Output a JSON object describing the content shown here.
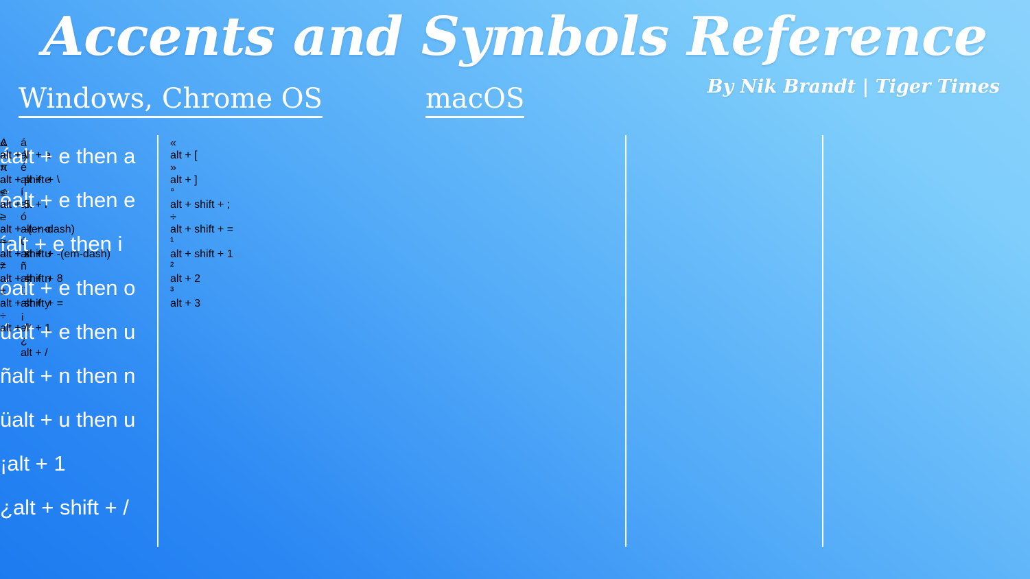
{
  "title": "Accents and Symbols Reference",
  "byline": "By Nik Brandt | Tiger Times",
  "headings": {
    "windows": "Windows, Chrome OS",
    "macos": "macOS"
  },
  "columns": [
    {
      "id": "col-1",
      "group": "windows",
      "rows": [
        {
          "symbol": "á",
          "keys": "alt + a"
        },
        {
          "symbol": "é",
          "keys": "alt + e"
        },
        {
          "symbol": "í",
          "keys": "alt + i"
        },
        {
          "symbol": "ó",
          "keys": "alt + o"
        },
        {
          "symbol": "ú",
          "keys": "alt + u"
        },
        {
          "symbol": "ñ",
          "keys": "alt + n"
        },
        {
          "symbol": "ü",
          "keys": "alt + y"
        },
        {
          "symbol": "¡",
          "keys": "alt + 1"
        },
        {
          "symbol": "¿",
          "keys": "alt + /"
        }
      ]
    },
    {
      "id": "col-2",
      "group": "windows",
      "rows": [
        {
          "symbol": "«",
          "keys": "alt + ["
        },
        {
          "symbol": "»",
          "keys": "alt + ]"
        },
        {
          "symbol": "",
          "keys": ""
        },
        {
          "symbol": "°",
          "keys": "alt + shift + ;"
        },
        {
          "symbol": "÷",
          "keys": "alt + shift + ="
        },
        {
          "symbol": "¹",
          "keys": "alt + shift + 1"
        },
        {
          "symbol": "²",
          "keys": "alt + 2"
        },
        {
          "symbol": "³",
          "keys": "alt + 3"
        },
        {
          "symbol": "",
          "keys": ""
        }
      ]
    },
    {
      "id": "col-3",
      "group": "macos",
      "rows": [
        {
          "symbol": "á",
          "keys": "alt + e then a"
        },
        {
          "symbol": "é",
          "keys": "alt + e then e"
        },
        {
          "symbol": "í",
          "keys": "alt + e then i"
        },
        {
          "symbol": "ó",
          "keys": "alt + e then o"
        },
        {
          "symbol": "ú",
          "keys": "alt + e then u"
        },
        {
          "symbol": "ñ",
          "keys": "alt + n then n"
        },
        {
          "symbol": "ü",
          "keys": "alt + u then u"
        },
        {
          "symbol": "¡",
          "keys": "alt + 1",
          "align": "center"
        },
        {
          "symbol": "¿",
          "keys": "alt + shift + /"
        }
      ]
    },
    {
      "id": "col-4",
      "group": "macos",
      "rows": [
        {
          "symbol": "«",
          "keys": "alt + \\"
        },
        {
          "symbol": "»",
          "keys": "alt + shift + \\"
        },
        {
          "symbol": "",
          "keys": ""
        },
        {
          "symbol": "≤",
          "keys": "alt + ,"
        },
        {
          "symbol": "≥",
          "keys": "alt + ."
        },
        {
          "symbol": "≈",
          "keys": "alt + x"
        },
        {
          "symbol": "≠",
          "keys": "alt + ="
        },
        {
          "symbol": "±",
          "keys": "alt + shift + ="
        },
        {
          "symbol": "÷",
          "keys": "alt + /"
        }
      ]
    },
    {
      "id": "col-5",
      "group": "macos",
      "rows": [
        {
          "symbol": "Δ",
          "keys": "alt + j"
        },
        {
          "symbol": "π",
          "keys": "alt + p"
        },
        {
          "symbol": "∞",
          "keys": "alt + 5"
        },
        {
          "symbol": "–",
          "keys": "alt + -",
          "keys2": "(en-dash)"
        },
        {
          "symbol": "—",
          "keys": "alt + shift + -",
          "keys2": "(em-dash)"
        },
        {
          "symbol": "°",
          "keys": "alt + shift + 8"
        },
        {
          "symbol": "",
          "keys": ""
        },
        {
          "symbol": "",
          "keys": ""
        },
        {
          "symbol": "",
          "keys": ""
        }
      ]
    }
  ],
  "colors": {
    "gradient_light": "#8bd3fd",
    "gradient_dark": "#1d7bf0",
    "text": "#ffffff"
  }
}
